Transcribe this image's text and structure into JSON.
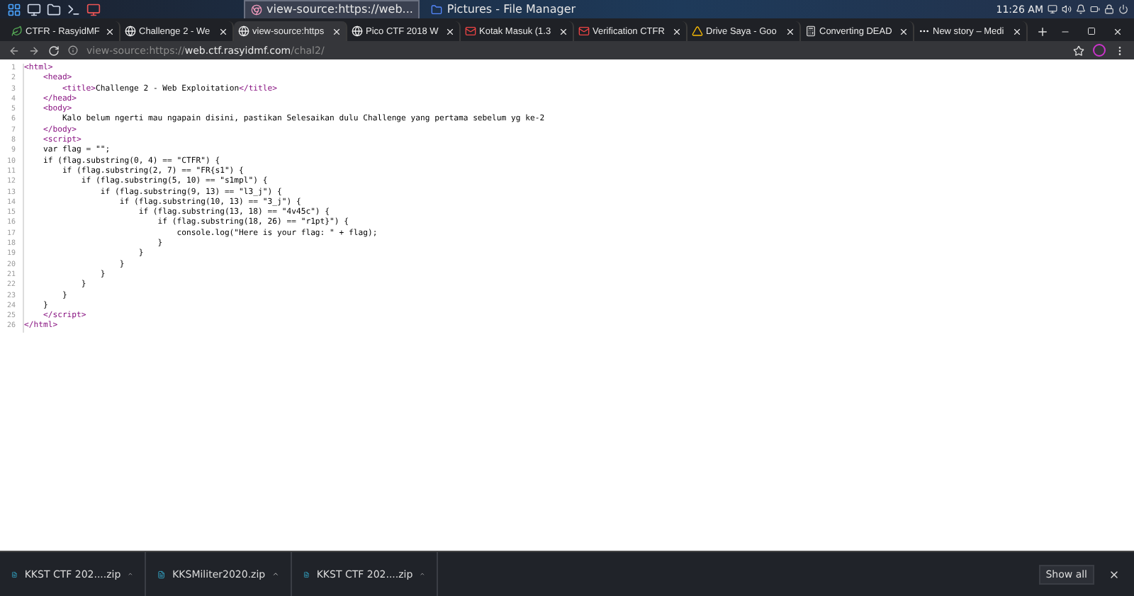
{
  "panel": {
    "tasks": [
      {
        "title": "view-source:https://web...",
        "kind": "browser",
        "selected": true
      },
      {
        "title": "Pictures - File Manager",
        "kind": "files",
        "selected": false
      }
    ],
    "clock": "11:26 AM"
  },
  "tabs": [
    {
      "title": "CTFR - RasyidMF",
      "kind": "leaf",
      "selected": false
    },
    {
      "title": "Challenge 2 - We",
      "kind": "globe",
      "selected": false
    },
    {
      "title": "view-source:https",
      "kind": "globe",
      "selected": true
    },
    {
      "title": "Pico CTF 2018 W",
      "kind": "globe",
      "selected": false
    },
    {
      "title": "Kotak Masuk (1.3",
      "kind": "mail",
      "selected": false
    },
    {
      "title": "Verification CTFR",
      "kind": "mail",
      "selected": false
    },
    {
      "title": "Drive Saya - Goo",
      "kind": "drive",
      "selected": false
    },
    {
      "title": "Converting DEAD",
      "kind": "calc",
      "selected": false
    },
    {
      "title": "New story – Medi",
      "kind": "medium",
      "selected": false
    }
  ],
  "address": {
    "prefix": "view-source:https://",
    "host": "web.ctf.rasyidmf.com",
    "path": "/chal2/"
  },
  "source": [
    {
      "number": "1",
      "parts": [
        {
          "kind": "tag",
          "text": "<html>"
        }
      ]
    },
    {
      "number": "2",
      "parts": [
        {
          "kind": "tag",
          "text": "    <head>"
        }
      ]
    },
    {
      "number": "3",
      "parts": [
        {
          "kind": "tag",
          "text": "        <title>"
        },
        {
          "kind": "text",
          "text": "Challenge 2 - Web Exploitation"
        },
        {
          "kind": "tag",
          "text": "</title>"
        }
      ]
    },
    {
      "number": "4",
      "parts": [
        {
          "kind": "tag",
          "text": "    </head>"
        }
      ]
    },
    {
      "number": "5",
      "parts": [
        {
          "kind": "tag",
          "text": "    <body>"
        }
      ]
    },
    {
      "number": "6",
      "parts": [
        {
          "kind": "text",
          "text": "        Kalo belum ngerti mau ngapain disini, pastikan Selesaikan dulu Challenge yang pertama sebelum yg ke-2"
        }
      ]
    },
    {
      "number": "7",
      "parts": [
        {
          "kind": "tag",
          "text": "    </body>"
        }
      ]
    },
    {
      "number": "8",
      "parts": [
        {
          "kind": "tag",
          "text": "    <script>"
        }
      ]
    },
    {
      "number": "9",
      "parts": [
        {
          "kind": "text",
          "text": "    var flag = \"\";"
        }
      ]
    },
    {
      "number": "10",
      "parts": [
        {
          "kind": "text",
          "text": "    if (flag.substring(0, 4) == \"CTFR\") {"
        }
      ]
    },
    {
      "number": "11",
      "parts": [
        {
          "kind": "text",
          "text": "        if (flag.substring(2, 7) == \"FR{s1\") {"
        }
      ]
    },
    {
      "number": "12",
      "parts": [
        {
          "kind": "text",
          "text": "            if (flag.substring(5, 10) == \"s1mpl\") {"
        }
      ]
    },
    {
      "number": "13",
      "parts": [
        {
          "kind": "text",
          "text": "                if (flag.substring(9, 13) == \"l3_j\") {"
        }
      ]
    },
    {
      "number": "14",
      "parts": [
        {
          "kind": "text",
          "text": "                    if (flag.substring(10, 13) == \"3_j\") {"
        }
      ]
    },
    {
      "number": "15",
      "parts": [
        {
          "kind": "text",
          "text": "                        if (flag.substring(13, 18) == \"4v45c\") {"
        }
      ]
    },
    {
      "number": "16",
      "parts": [
        {
          "kind": "text",
          "text": "                            if (flag.substring(18, 26) == \"r1pt}\") {"
        }
      ]
    },
    {
      "number": "17",
      "parts": [
        {
          "kind": "text",
          "text": "                                console.log(\"Here is your flag: \" + flag);"
        }
      ]
    },
    {
      "number": "18",
      "parts": [
        {
          "kind": "text",
          "text": "                            }"
        }
      ]
    },
    {
      "number": "19",
      "parts": [
        {
          "kind": "text",
          "text": "                        }"
        }
      ]
    },
    {
      "number": "20",
      "parts": [
        {
          "kind": "text",
          "text": "                    }"
        }
      ]
    },
    {
      "number": "21",
      "parts": [
        {
          "kind": "text",
          "text": "                }"
        }
      ]
    },
    {
      "number": "22",
      "parts": [
        {
          "kind": "text",
          "text": "            }"
        }
      ]
    },
    {
      "number": "23",
      "parts": [
        {
          "kind": "text",
          "text": "        }"
        }
      ]
    },
    {
      "number": "24",
      "parts": [
        {
          "kind": "text",
          "text": "    }"
        }
      ]
    },
    {
      "number": "25",
      "parts": [
        {
          "kind": "tag",
          "text": "    </script>"
        }
      ]
    },
    {
      "number": "26",
      "parts": [
        {
          "kind": "tag",
          "text": "</html>"
        }
      ]
    }
  ],
  "downloads": [
    {
      "name": "KKST CTF 202....zip"
    },
    {
      "name": "KKSMiliter2020.zip"
    },
    {
      "name": "KKST CTF 202....zip"
    }
  ],
  "show_all": "Show all"
}
